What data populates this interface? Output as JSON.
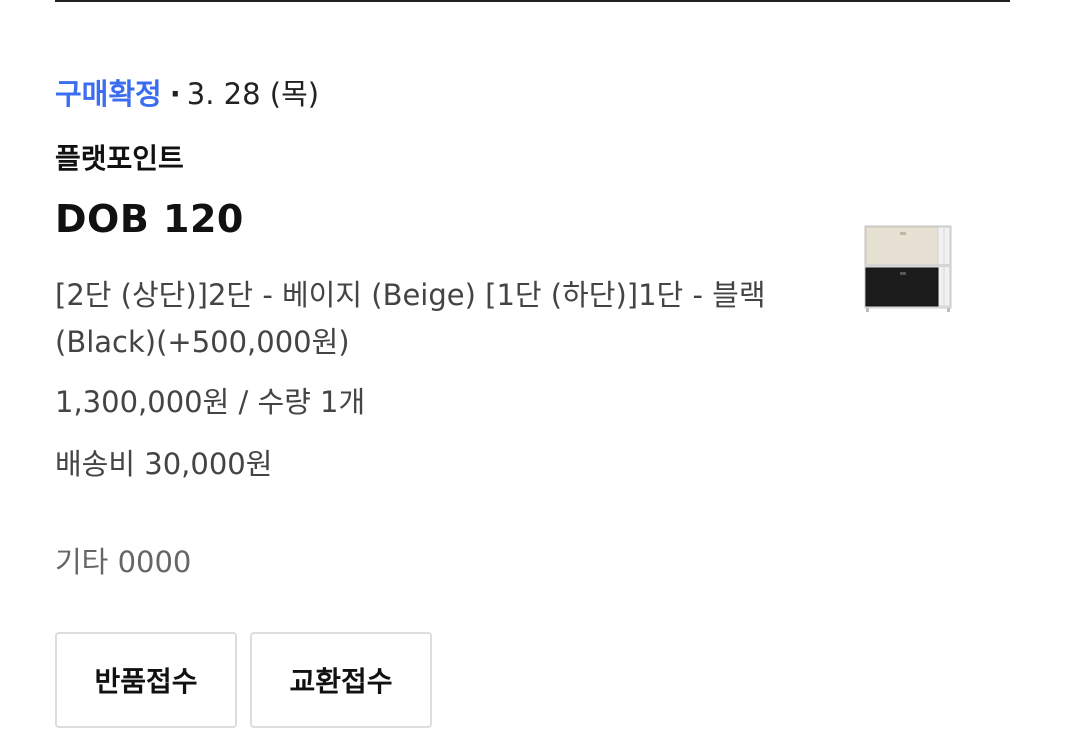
{
  "order": {
    "status": "구매확정",
    "separator": "·",
    "date": "3. 28 (목)",
    "seller": "플랫포인트",
    "product_name": "DOB 120",
    "option": "[2단 (상단)]2단 - 베이지 (Beige) [1단 (하단)]1단 - 블랙 (Black)(+500,000원)",
    "price_qty": "1,300,000원 / 수량 1개",
    "shipping": "배송비 30,000원",
    "etc": "기타 0000",
    "thumbnail": "product-thumbnail-cabinet"
  },
  "actions": {
    "return_label": "반품접수",
    "exchange_label": "교환접수"
  },
  "colors": {
    "status_accent": "#3b6df0",
    "text_primary": "#111111",
    "text_secondary": "#444444",
    "button_border": "#dddddd"
  }
}
